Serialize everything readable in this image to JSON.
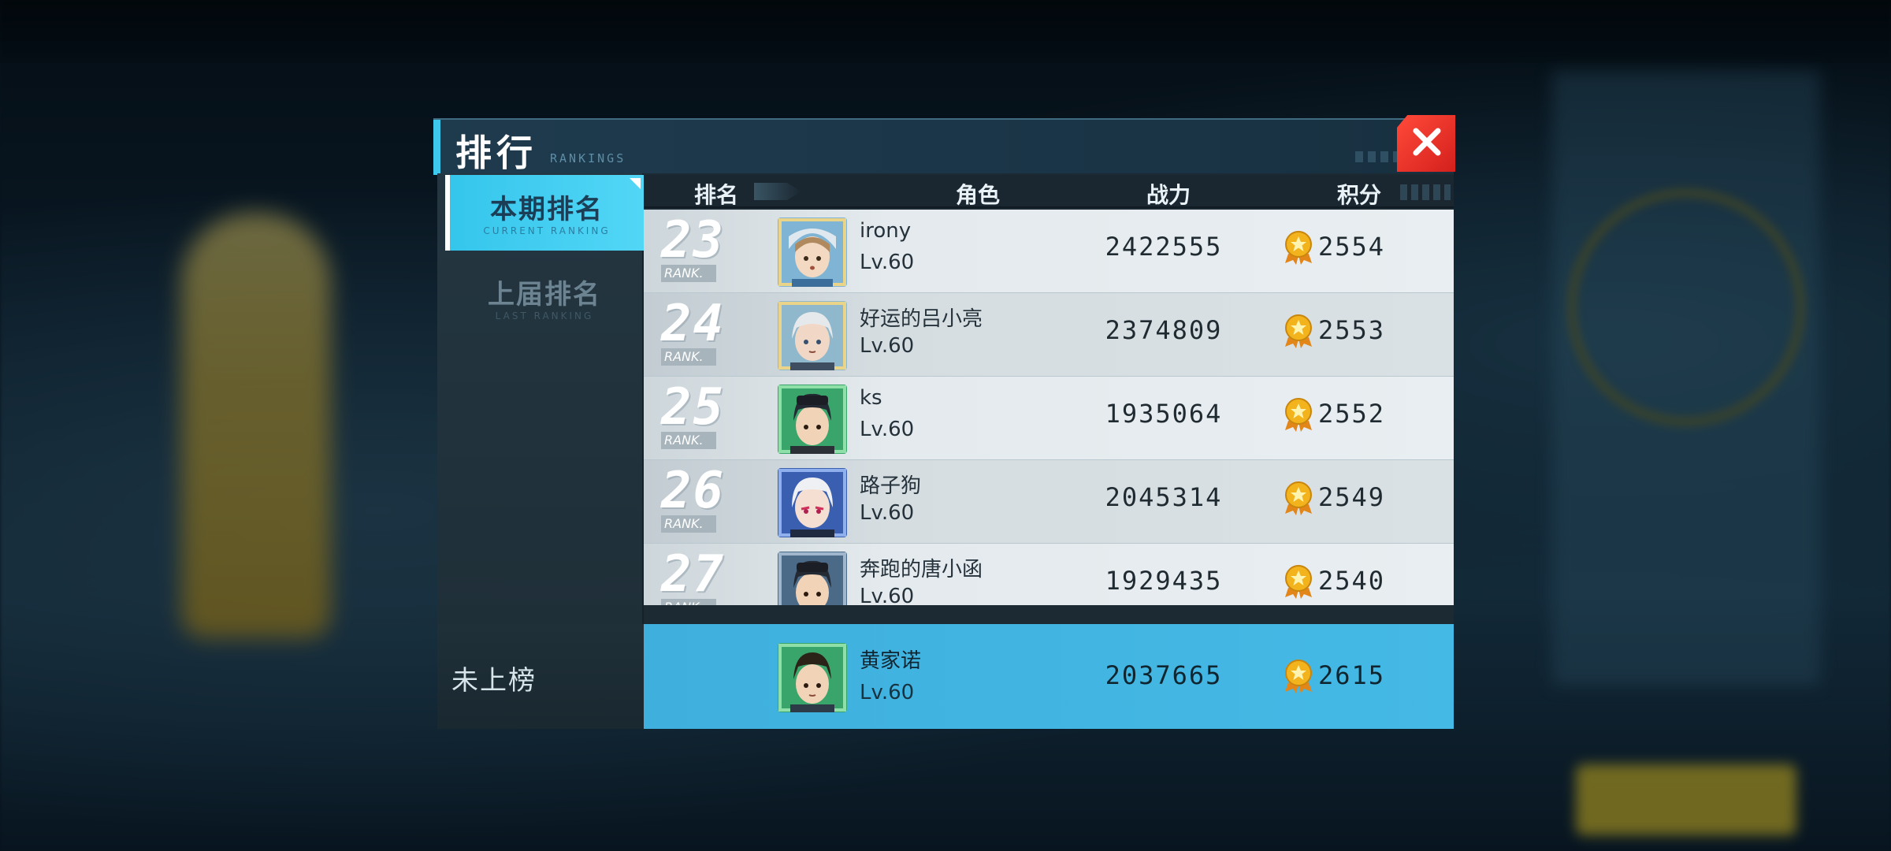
{
  "dialog": {
    "title": "排行",
    "subtitle": "RANKINGS",
    "close_icon": "close-icon"
  },
  "sidebar": {
    "tabs": [
      {
        "label": "本期排名",
        "sub": "CURRENT RANKING",
        "active": true
      },
      {
        "label": "上届排名",
        "sub": "LAST RANKING",
        "active": false
      }
    ]
  },
  "table": {
    "headers": {
      "rank": "排名",
      "role": "角色",
      "power": "战力",
      "points": "积分"
    },
    "rank_tag": "RANK.",
    "rows": [
      {
        "rank": "23",
        "name": "irony",
        "level": "Lv.60",
        "power": "2422555",
        "points": "2554"
      },
      {
        "rank": "24",
        "name": "好运的吕小亮",
        "level": "Lv.60",
        "power": "2374809",
        "points": "2553"
      },
      {
        "rank": "25",
        "name": "ks",
        "level": "Lv.60",
        "power": "1935064",
        "points": "2552"
      },
      {
        "rank": "26",
        "name": "路子狗",
        "level": "Lv.60",
        "power": "2045314",
        "points": "2549"
      },
      {
        "rank": "27",
        "name": "奔跑的唐小函",
        "level": "Lv.60",
        "power": "1929435",
        "points": "2540"
      }
    ]
  },
  "self": {
    "status": "未上榜",
    "name": "黄家诺",
    "level": "Lv.60",
    "power": "2037665",
    "points": "2615"
  },
  "colors": {
    "accent": "#3ec8ee",
    "close": "#e2302a",
    "self_row": "#43b6e3",
    "medal": "#f2b31c"
  }
}
